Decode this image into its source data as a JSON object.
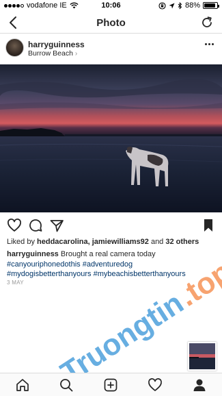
{
  "status": {
    "carrier": "vodafone IE",
    "time": "10:06",
    "battery": "88%",
    "battery_level": 0.88,
    "signal_bars": 4
  },
  "nav": {
    "title": "Photo",
    "back_icon": "chevron-left-icon",
    "refresh_icon": "refresh-icon"
  },
  "post": {
    "username": "harryguinness",
    "location": "Burrow Beach",
    "likes_prefix": "Liked by ",
    "likers": "heddacarolina, jamiewilliams92",
    "likes_and": " and ",
    "others": "32 others",
    "caption_user": "harryguinness",
    "caption_text": " Brought a real camera today",
    "hashtags": [
      "#canyouriphonedothis",
      "#adventuredog",
      "#mydogisbetterthanyours",
      "#mybeachisbetterthanyours"
    ],
    "date": "3 MAY"
  },
  "watermark": "Truongtin.top",
  "colors": {
    "hashtag": "#003569",
    "watermark_blue": "#2e8fd6",
    "watermark_orange": "#f4813a"
  },
  "tabs": [
    "home-icon",
    "search-icon",
    "add-post-icon",
    "heart-icon",
    "profile-icon"
  ]
}
